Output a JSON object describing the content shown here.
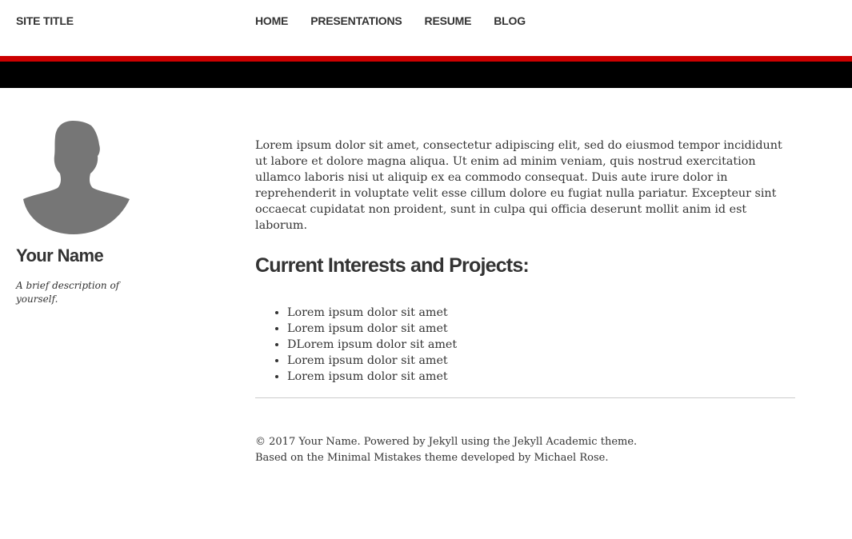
{
  "header": {
    "site_title": "SITE TITLE",
    "nav": [
      "HOME",
      "PRESENTATIONS",
      "RESUME",
      "BLOG"
    ]
  },
  "colors": {
    "accent_red": "#cc0000",
    "band_black": "#000000",
    "text": "#333333",
    "avatar_gray": "#767676"
  },
  "sidebar": {
    "avatar_icon": "person-silhouette-icon",
    "name": "Your Name",
    "bio": "A brief description of yourself."
  },
  "main": {
    "intro": "Lorem ipsum dolor sit amet, consectetur adipiscing elit, sed do eiusmod tempor incididunt ut labore et dolore magna aliqua. Ut enim ad minim veniam, quis nostrud exercitation ullamco laboris nisi ut aliquip ex ea commodo consequat. Duis aute irure dolor in reprehenderit in voluptate velit esse cillum dolore eu fugiat nulla pariatur. Excepteur sint occaecat cupidatat non proident, sunt in culpa qui officia deserunt mollit anim id est laborum.",
    "section_title": "Current Interests and Projects:",
    "projects": [
      "Lorem ipsum dolor sit amet",
      "Lorem ipsum dolor sit amet",
      "DLorem ipsum dolor sit amet",
      "Lorem ipsum dolor sit amet",
      "Lorem ipsum dolor sit amet"
    ]
  },
  "footer": {
    "line1": "© 2017 Your Name. Powered by Jekyll using the Jekyll Academic theme.",
    "line2": "Based on the Minimal Mistakes theme developed by Michael Rose."
  }
}
